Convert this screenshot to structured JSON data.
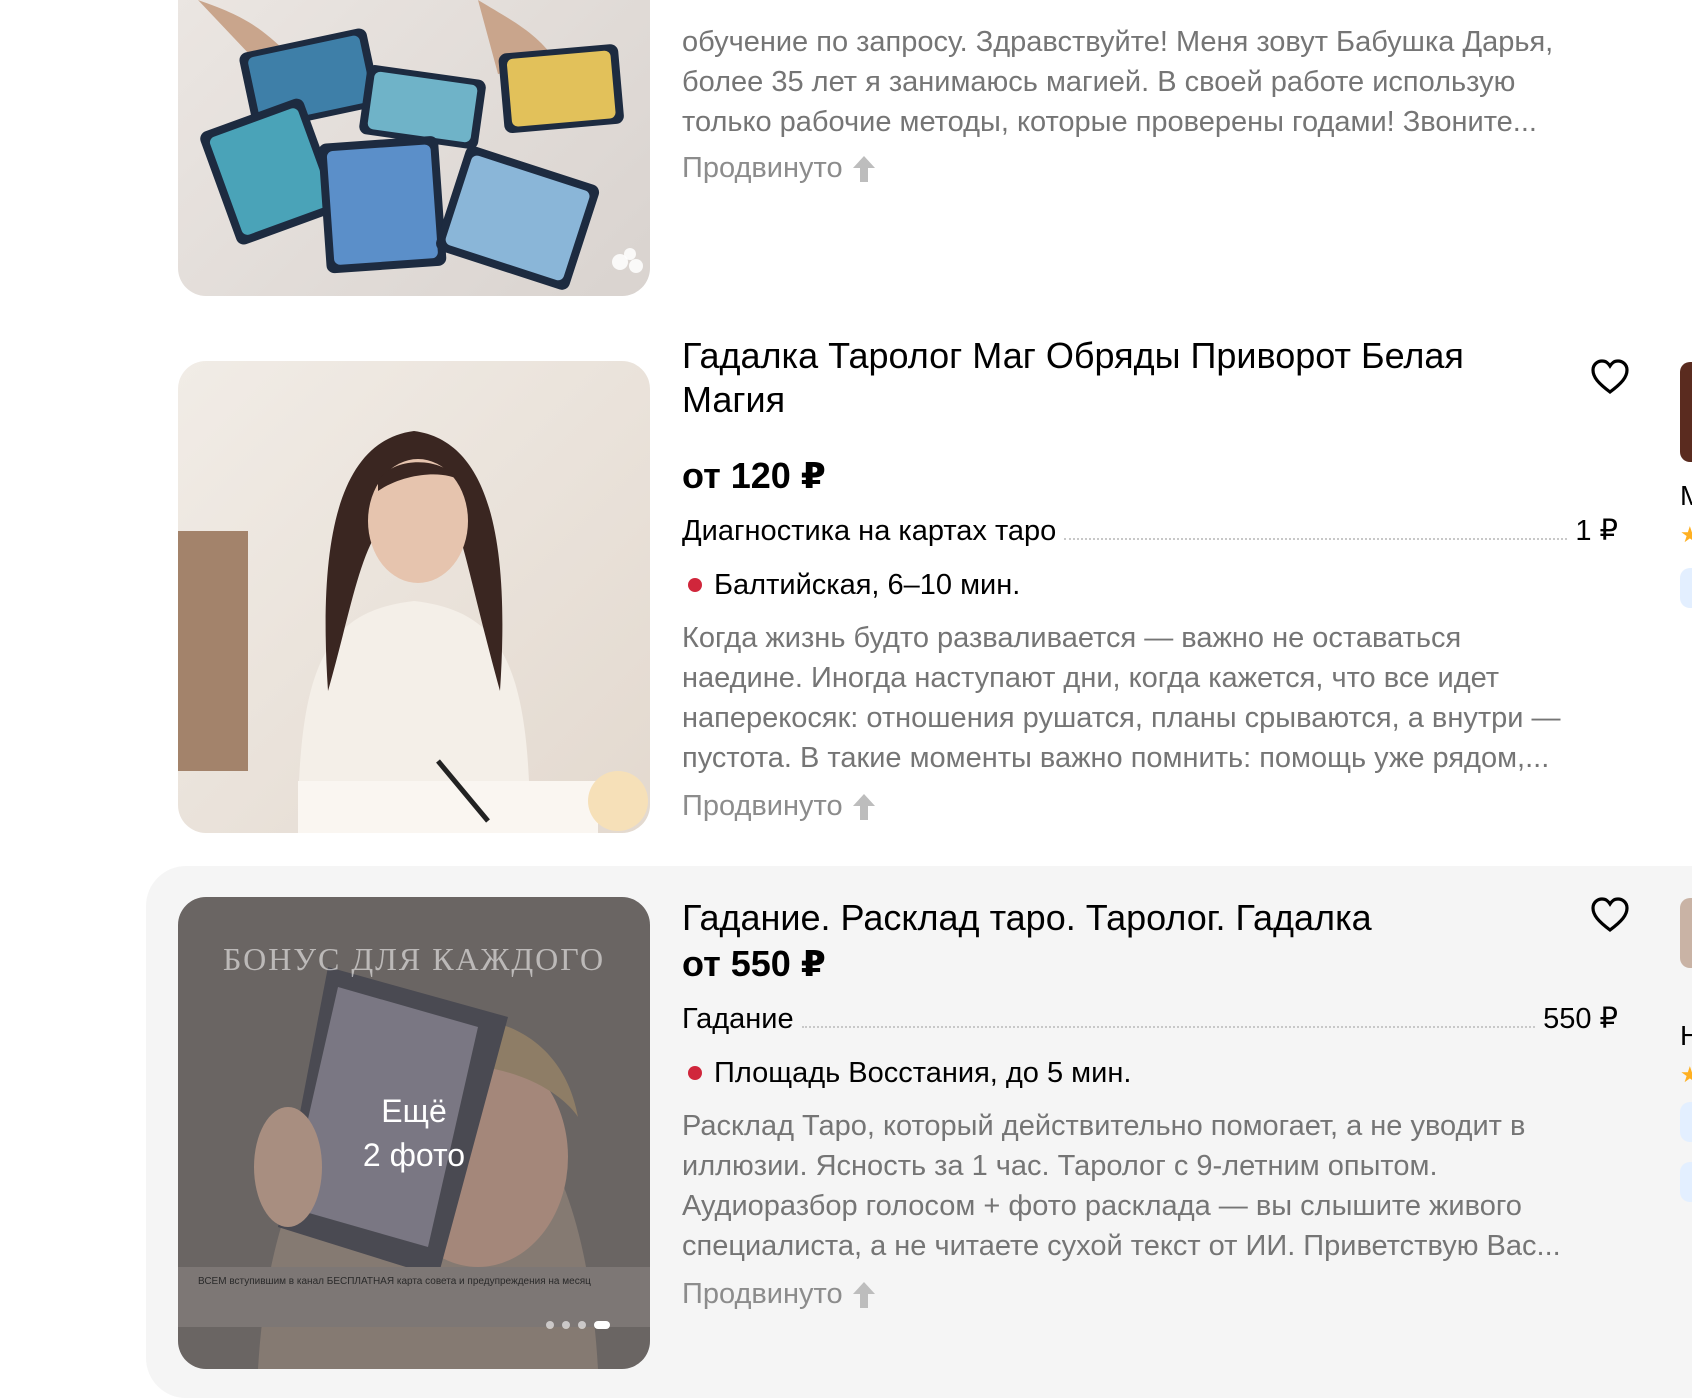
{
  "listings": [
    {
      "description_lines": [
        "обучение по запросу. Здравствуйте! Меня зовут Бабушка Дарья,",
        "более 35 лет я занимаюсь магией. В своей работе использую",
        "только рабочие методы, которые проверены годами! Звоните..."
      ],
      "promoted": "Продвинуто",
      "photo_icon": "tarot-cards-photo"
    },
    {
      "title": "Гадалка Таролог Маг Обряды Приворот Белая Магия",
      "price": "от 120 ₽",
      "service": {
        "name": "Диагностика на картах таро",
        "price": "1 ₽"
      },
      "metro": "Балтийская, 6–10 мин.",
      "metro_color": "#d0263b",
      "description_lines": [
        "Когда жизнь будто разваливается — важно не оставаться",
        "наедине. Иногда наступают дни, когда кажется, что все идет",
        "наперекосяк: отношения рушатся, планы срываются, а внутри —",
        "пустота. В такие моменты важно помнить: помощь уже рядом,..."
      ],
      "promoted": "Продвинуто",
      "favorite_icon": "heart-icon",
      "photo_icon": "woman-writing-photo"
    },
    {
      "title": "Гадание. Расклад таро. Таролог. Гадалка",
      "price": "от 550 ₽",
      "service": {
        "name": "Гадание",
        "price": "550 ₽"
      },
      "metro": "Площадь Восстания, до 5 мин.",
      "metro_color": "#d0263b",
      "description_lines": [
        "Расклад Таро, который действительно помогает, а не уводит в",
        "иллюзии. Ясность за 1 час. Таролог с 9-летним опытом.",
        "Аудиоразбор голосом + фото расклада — вы слышите живого",
        "специалиста, а не читаете сухой текст от ИИ. Приветствую Вас..."
      ],
      "promoted": "Продвинуто",
      "favorite_icon": "heart-icon",
      "photo_overlay": {
        "line1": "Ещё",
        "line2": "2 фото"
      },
      "photo_banner": "БОНУС ДЛЯ КАЖДОГО",
      "photo_caption": "ВСЕМ вступившим в канал БЕСПЛАТНАЯ карта совета и предупреждения на месяц",
      "photo_icon": "tarot-woman-photo"
    }
  ],
  "edge": {
    "letter1": "М",
    "letter2": "Н"
  },
  "colors": {
    "accent_red": "#d0263b",
    "muted_text": "#757575",
    "hover_bg": "#f5f5f5"
  }
}
